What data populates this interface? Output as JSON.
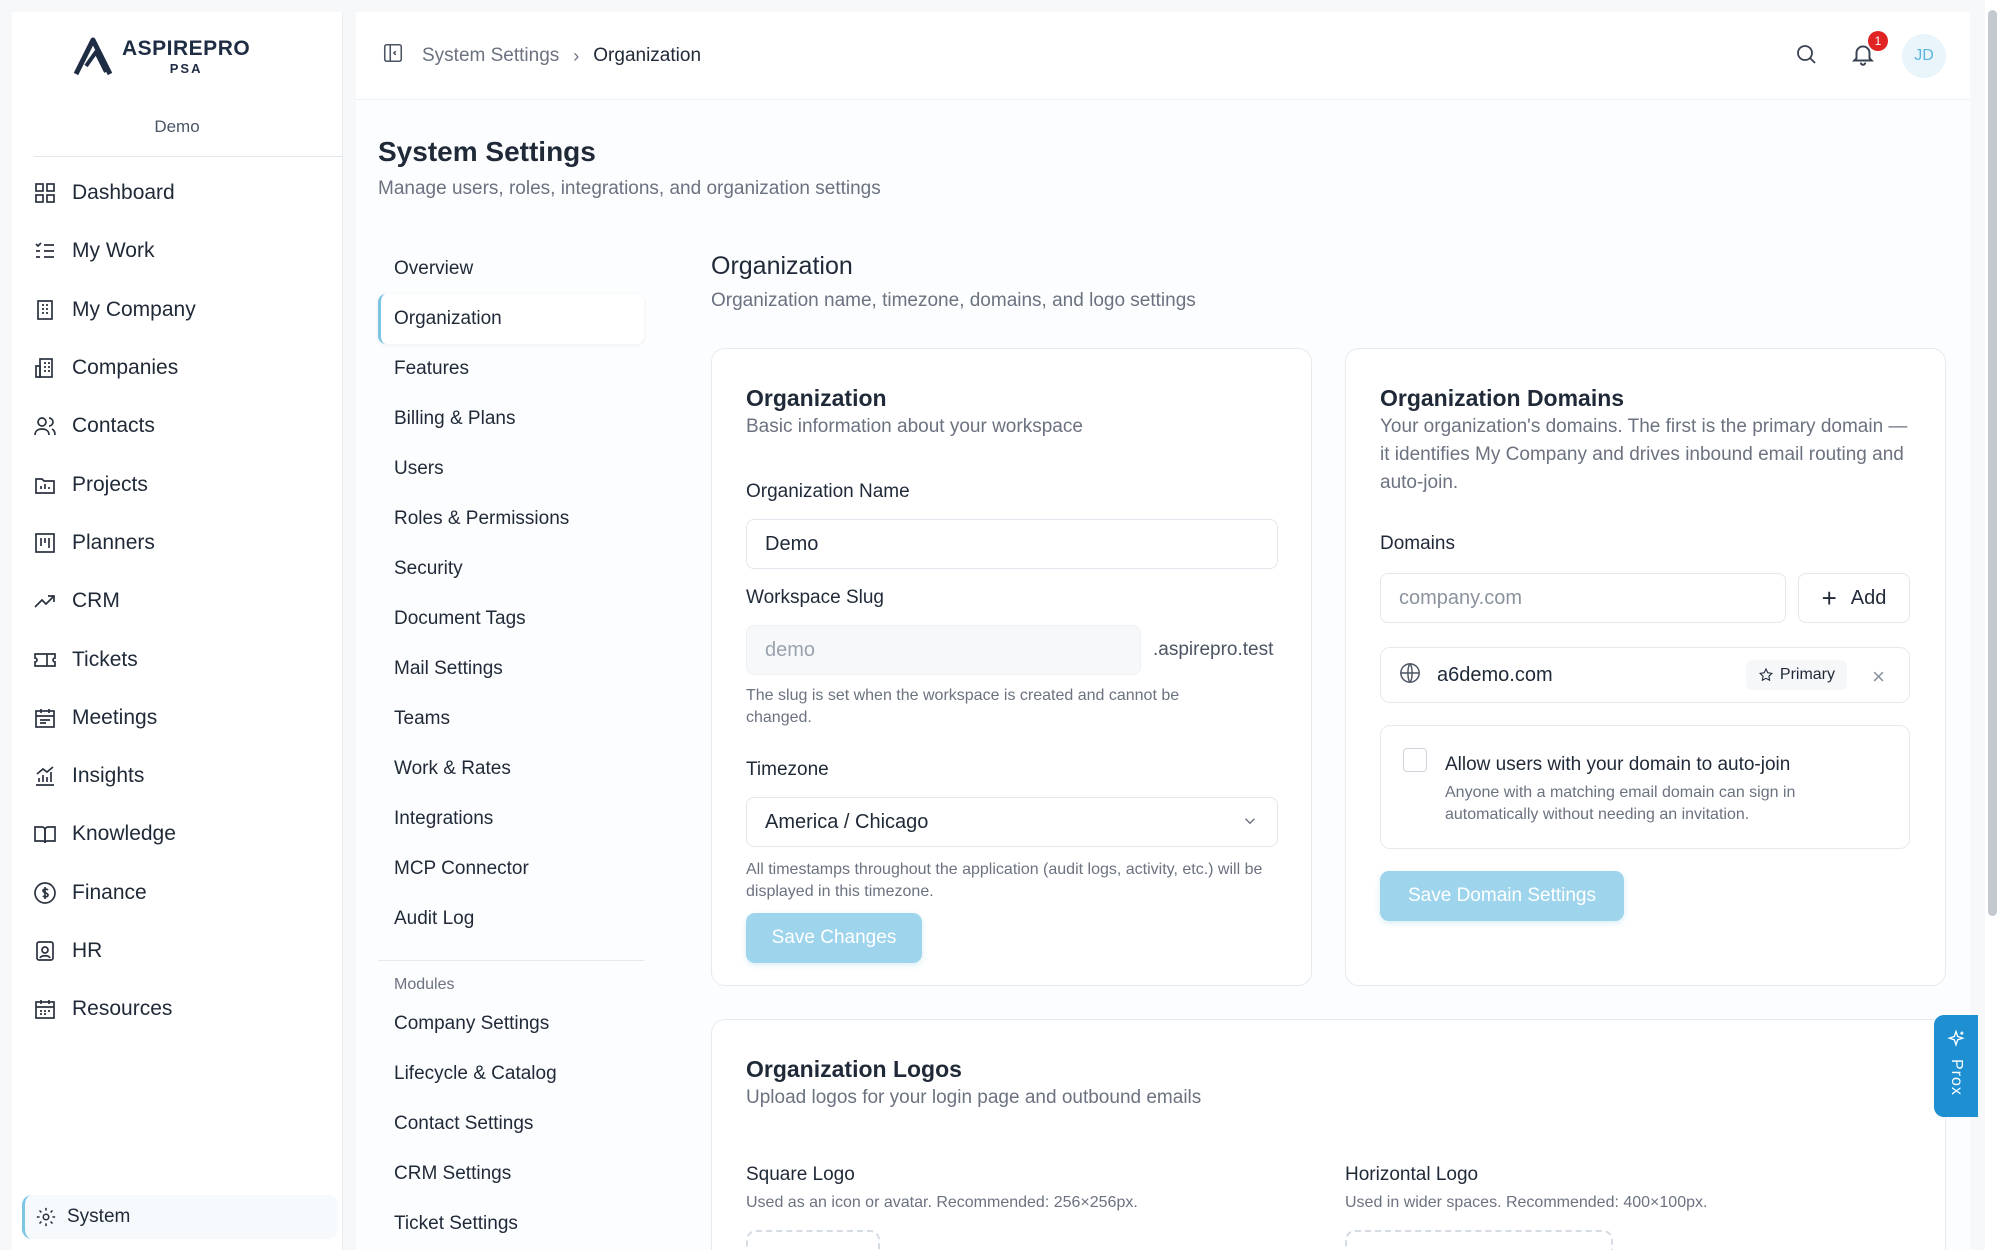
{
  "brand": {
    "name": "ASPIREPRO",
    "sub": "PSA",
    "org": "Demo"
  },
  "nav": [
    {
      "label": "Dashboard",
      "icon": "dashboard-icon"
    },
    {
      "label": "My Work",
      "icon": "list-check-icon"
    },
    {
      "label": "My Company",
      "icon": "building-icon"
    },
    {
      "label": "Companies",
      "icon": "buildings-icon"
    },
    {
      "label": "Contacts",
      "icon": "users-icon"
    },
    {
      "label": "Projects",
      "icon": "folder-icon"
    },
    {
      "label": "Planners",
      "icon": "kanban-icon"
    },
    {
      "label": "CRM",
      "icon": "trending-up-icon"
    },
    {
      "label": "Tickets",
      "icon": "ticket-icon"
    },
    {
      "label": "Meetings",
      "icon": "calendar-icon"
    },
    {
      "label": "Insights",
      "icon": "chart-icon"
    },
    {
      "label": "Knowledge",
      "icon": "book-icon"
    },
    {
      "label": "Finance",
      "icon": "dollar-icon"
    },
    {
      "label": "HR",
      "icon": "id-badge-icon"
    },
    {
      "label": "Resources",
      "icon": "calendar-grid-icon"
    }
  ],
  "system_label": "System",
  "breadcrumb": {
    "parent": "System Settings",
    "separator": "›",
    "current": "Organization"
  },
  "notifications": {
    "count": "1"
  },
  "user": {
    "initials": "JD"
  },
  "page": {
    "title": "System Settings",
    "subtitle": "Manage users, roles, integrations, and organization settings"
  },
  "settings_nav": {
    "items": [
      "Overview",
      "Organization",
      "Features",
      "Billing & Plans",
      "Users",
      "Roles & Permissions",
      "Security",
      "Document Tags",
      "Mail Settings",
      "Teams",
      "Work & Rates",
      "Integrations",
      "MCP Connector",
      "Audit Log"
    ],
    "active": "Organization",
    "modules_heading": "Modules",
    "modules": [
      "Company Settings",
      "Lifecycle & Catalog",
      "Contact Settings",
      "CRM Settings",
      "Ticket Settings"
    ]
  },
  "section": {
    "title": "Organization",
    "subtitle": "Organization name, timezone, domains, and logo settings"
  },
  "org_card": {
    "title": "Organization",
    "subtitle": "Basic information about your workspace",
    "name_label": "Organization Name",
    "name_value": "Demo",
    "slug_label": "Workspace Slug",
    "slug_value": "demo",
    "slug_suffix": ".aspirepro.test",
    "slug_hint": "The slug is set when the workspace is created and cannot be changed.",
    "timezone_label": "Timezone",
    "timezone_value": "America / Chicago",
    "timezone_hint": "All timestamps throughout the application (audit logs, activity, etc.) will be displayed in this timezone.",
    "save_label": "Save Changes"
  },
  "domains_card": {
    "title": "Organization Domains",
    "subtitle": "Your organization's domains. The first is the primary domain — it identifies My Company and drives inbound email routing and auto-join.",
    "domains_label": "Domains",
    "domain_placeholder": "company.com",
    "add_label": "Add",
    "domains": [
      {
        "name": "a6demo.com",
        "badge": "Primary"
      }
    ],
    "autojoin_title": "Allow users with your domain to auto-join",
    "autojoin_sub": "Anyone with a matching email domain can sign in automatically without needing an invitation.",
    "autojoin_checked": false,
    "save_label": "Save Domain Settings"
  },
  "logos_card": {
    "title": "Organization Logos",
    "subtitle": "Upload logos for your login page and outbound emails",
    "square_label": "Square Logo",
    "square_hint": "Used as an icon or avatar. Recommended: 256×256px.",
    "horizontal_label": "Horizontal Logo",
    "horizontal_hint": "Used in wider spaces. Recommended: 400×100px."
  },
  "prox": {
    "label": "Prox"
  },
  "colors": {
    "accent": "#7cc6e4",
    "button": "#9ed4ec",
    "badge": "#e02424",
    "prox": "#1e8fd1"
  }
}
